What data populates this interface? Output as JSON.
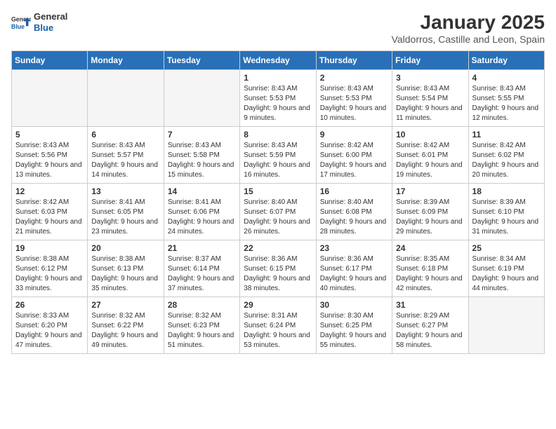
{
  "header": {
    "logo_general": "General",
    "logo_blue": "Blue",
    "month_year": "January 2025",
    "location": "Valdorros, Castille and Leon, Spain"
  },
  "days_of_week": [
    "Sunday",
    "Monday",
    "Tuesday",
    "Wednesday",
    "Thursday",
    "Friday",
    "Saturday"
  ],
  "weeks": [
    [
      {
        "day": "",
        "empty": true
      },
      {
        "day": "",
        "empty": true
      },
      {
        "day": "",
        "empty": true
      },
      {
        "day": "1",
        "sunrise": "8:43 AM",
        "sunset": "5:53 PM",
        "daylight": "9 hours and 9 minutes."
      },
      {
        "day": "2",
        "sunrise": "8:43 AM",
        "sunset": "5:53 PM",
        "daylight": "9 hours and 10 minutes."
      },
      {
        "day": "3",
        "sunrise": "8:43 AM",
        "sunset": "5:54 PM",
        "daylight": "9 hours and 11 minutes."
      },
      {
        "day": "4",
        "sunrise": "8:43 AM",
        "sunset": "5:55 PM",
        "daylight": "9 hours and 12 minutes."
      }
    ],
    [
      {
        "day": "5",
        "sunrise": "8:43 AM",
        "sunset": "5:56 PM",
        "daylight": "9 hours and 13 minutes."
      },
      {
        "day": "6",
        "sunrise": "8:43 AM",
        "sunset": "5:57 PM",
        "daylight": "9 hours and 14 minutes."
      },
      {
        "day": "7",
        "sunrise": "8:43 AM",
        "sunset": "5:58 PM",
        "daylight": "9 hours and 15 minutes."
      },
      {
        "day": "8",
        "sunrise": "8:43 AM",
        "sunset": "5:59 PM",
        "daylight": "9 hours and 16 minutes."
      },
      {
        "day": "9",
        "sunrise": "8:42 AM",
        "sunset": "6:00 PM",
        "daylight": "9 hours and 17 minutes."
      },
      {
        "day": "10",
        "sunrise": "8:42 AM",
        "sunset": "6:01 PM",
        "daylight": "9 hours and 19 minutes."
      },
      {
        "day": "11",
        "sunrise": "8:42 AM",
        "sunset": "6:02 PM",
        "daylight": "9 hours and 20 minutes."
      }
    ],
    [
      {
        "day": "12",
        "sunrise": "8:42 AM",
        "sunset": "6:03 PM",
        "daylight": "9 hours and 21 minutes."
      },
      {
        "day": "13",
        "sunrise": "8:41 AM",
        "sunset": "6:05 PM",
        "daylight": "9 hours and 23 minutes."
      },
      {
        "day": "14",
        "sunrise": "8:41 AM",
        "sunset": "6:06 PM",
        "daylight": "9 hours and 24 minutes."
      },
      {
        "day": "15",
        "sunrise": "8:40 AM",
        "sunset": "6:07 PM",
        "daylight": "9 hours and 26 minutes."
      },
      {
        "day": "16",
        "sunrise": "8:40 AM",
        "sunset": "6:08 PM",
        "daylight": "9 hours and 28 minutes."
      },
      {
        "day": "17",
        "sunrise": "8:39 AM",
        "sunset": "6:09 PM",
        "daylight": "9 hours and 29 minutes."
      },
      {
        "day": "18",
        "sunrise": "8:39 AM",
        "sunset": "6:10 PM",
        "daylight": "9 hours and 31 minutes."
      }
    ],
    [
      {
        "day": "19",
        "sunrise": "8:38 AM",
        "sunset": "6:12 PM",
        "daylight": "9 hours and 33 minutes."
      },
      {
        "day": "20",
        "sunrise": "8:38 AM",
        "sunset": "6:13 PM",
        "daylight": "9 hours and 35 minutes."
      },
      {
        "day": "21",
        "sunrise": "8:37 AM",
        "sunset": "6:14 PM",
        "daylight": "9 hours and 37 minutes."
      },
      {
        "day": "22",
        "sunrise": "8:36 AM",
        "sunset": "6:15 PM",
        "daylight": "9 hours and 38 minutes."
      },
      {
        "day": "23",
        "sunrise": "8:36 AM",
        "sunset": "6:17 PM",
        "daylight": "9 hours and 40 minutes."
      },
      {
        "day": "24",
        "sunrise": "8:35 AM",
        "sunset": "6:18 PM",
        "daylight": "9 hours and 42 minutes."
      },
      {
        "day": "25",
        "sunrise": "8:34 AM",
        "sunset": "6:19 PM",
        "daylight": "9 hours and 44 minutes."
      }
    ],
    [
      {
        "day": "26",
        "sunrise": "8:33 AM",
        "sunset": "6:20 PM",
        "daylight": "9 hours and 47 minutes."
      },
      {
        "day": "27",
        "sunrise": "8:32 AM",
        "sunset": "6:22 PM",
        "daylight": "9 hours and 49 minutes."
      },
      {
        "day": "28",
        "sunrise": "8:32 AM",
        "sunset": "6:23 PM",
        "daylight": "9 hours and 51 minutes."
      },
      {
        "day": "29",
        "sunrise": "8:31 AM",
        "sunset": "6:24 PM",
        "daylight": "9 hours and 53 minutes."
      },
      {
        "day": "30",
        "sunrise": "8:30 AM",
        "sunset": "6:25 PM",
        "daylight": "9 hours and 55 minutes."
      },
      {
        "day": "31",
        "sunrise": "8:29 AM",
        "sunset": "6:27 PM",
        "daylight": "9 hours and 58 minutes."
      },
      {
        "day": "",
        "empty": true
      }
    ]
  ],
  "labels": {
    "sunrise": "Sunrise:",
    "sunset": "Sunset:",
    "daylight": "Daylight:"
  }
}
